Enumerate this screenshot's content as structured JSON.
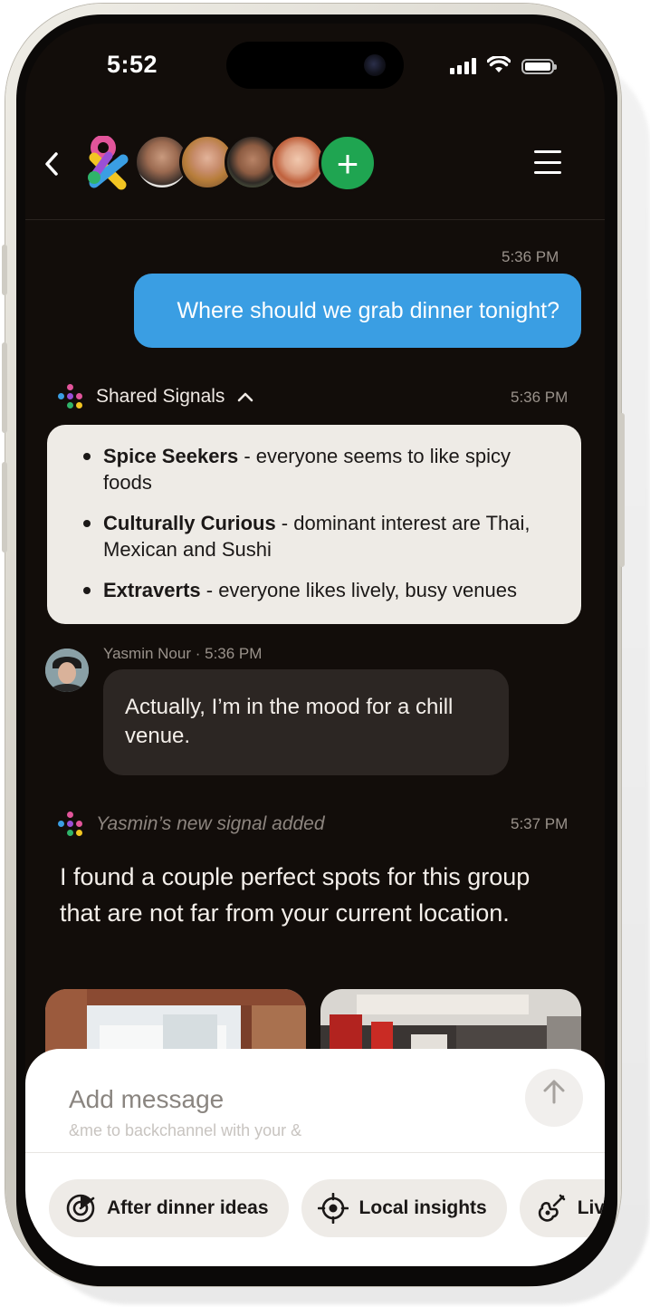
{
  "status_bar": {
    "time": "5:52"
  },
  "header": {
    "back_icon": "chevron-left-icon",
    "members": [
      "member-1",
      "member-2",
      "member-3",
      "member-4"
    ],
    "menu_icon": "hamburger-icon"
  },
  "messages": {
    "outgoing_time": "5:36 PM",
    "outgoing_text": "Where should we grab dinner tonight?",
    "signals": {
      "title": "Shared Signals",
      "time": "5:36 PM",
      "items": [
        {
          "name": "Spice Seekers",
          "desc": " - everyone seems to like spicy foods"
        },
        {
          "name": "Culturally Curious",
          "desc": " - dominant interest are Thai, Mexican and Sushi"
        },
        {
          "name": "Extraverts",
          "desc": " - everyone likes lively, busy venues"
        }
      ]
    },
    "yasmin": {
      "name": "Yasmin Nour",
      "separator": " · ",
      "time": "5:36 PM",
      "text": "Actually, I’m in the mood for a chill venue."
    },
    "new_signal": {
      "label": "Yasmin’s new signal added",
      "time": "5:37 PM"
    },
    "reply": "I found a couple perfect spots for this group that are not far from your current location."
  },
  "composer": {
    "placeholder": "Add message",
    "hint": "&me to backchannel with your &",
    "send_icon": "arrow-up-icon"
  },
  "chips": [
    {
      "label": "After dinner ideas",
      "icon": "radar-icon"
    },
    {
      "label": "Local insights",
      "icon": "target-icon"
    },
    {
      "label": "Live",
      "icon": "guitar-icon"
    }
  ],
  "colors": {
    "background": "#120d0a",
    "outgoing_bubble": "#3a9ee3",
    "incoming_bubble": "#2c2623",
    "signals_card": "#eeebe6",
    "add_button": "#1fa551"
  }
}
